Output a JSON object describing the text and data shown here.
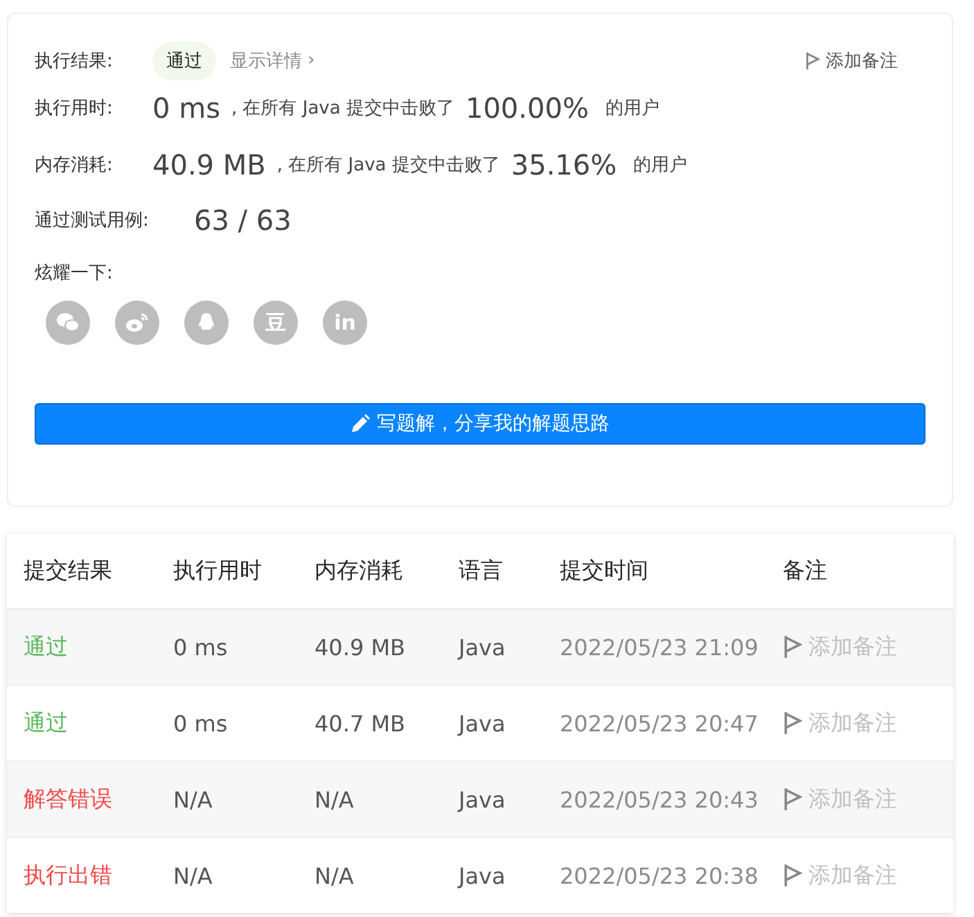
{
  "result": {
    "label": "执行结果:",
    "status": "通过",
    "details_link": "显示详情",
    "details_arrow": "›",
    "add_note": "添加备注"
  },
  "runtime": {
    "label": "执行用时:",
    "value": "0 ms",
    "text": ", 在所有 Java 提交中击败了",
    "percent": "100.00%",
    "suffix": "的用户"
  },
  "memory": {
    "label": "内存消耗:",
    "value": "40.9 MB",
    "text": ", 在所有 Java 提交中击败了",
    "percent": "35.16%",
    "suffix": "的用户"
  },
  "testcases": {
    "label": "通过测试用例:",
    "value": "63 / 63"
  },
  "share": {
    "label": "炫耀一下:",
    "buttons": [
      {
        "kind": "chat"
      },
      {
        "kind": "swirl"
      },
      {
        "kind": "penguin"
      },
      {
        "kind": "text",
        "text": "豆"
      },
      {
        "kind": "text",
        "text": "in"
      }
    ]
  },
  "write_solution_button": "写题解，分享我的解题思路",
  "table": {
    "columns": [
      "提交结果",
      "执行用时",
      "内存消耗",
      "语言",
      "提交时间",
      "备注"
    ],
    "rows": [
      {
        "status": "通过",
        "color": "#5cb85c",
        "runtime": "0 ms",
        "memory": "40.9 MB",
        "language": "Java",
        "time": "2022/05/23 21:09",
        "note": "添加备注"
      },
      {
        "status": "通过",
        "color": "#5cb85c",
        "runtime": "0 ms",
        "memory": "40.7 MB",
        "language": "Java",
        "time": "2022/05/23 20:47",
        "note": "添加备注"
      },
      {
        "status": "解答错误",
        "color": "#f04a48",
        "runtime": "N/A",
        "memory": "N/A",
        "language": "Java",
        "time": "2022/05/23 20:43",
        "note": "添加备注"
      },
      {
        "status": "执行出错",
        "color": "#f04a48",
        "runtime": "N/A",
        "memory": "N/A",
        "language": "Java",
        "time": "2022/05/23 20:38",
        "note": "添加备注"
      }
    ]
  }
}
